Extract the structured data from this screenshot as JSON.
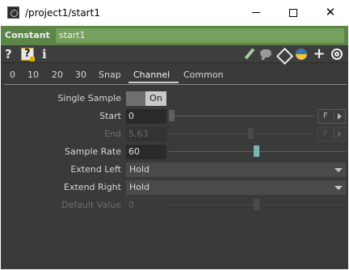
{
  "window": {
    "title": "/project1/start1"
  },
  "header": {
    "op_type": "Constant",
    "op_name": "start1"
  },
  "toolbar": {
    "help_label": "?",
    "python_help_label": "?",
    "info_label": "i",
    "plus_label": "+"
  },
  "tabs": [
    {
      "label": "0"
    },
    {
      "label": "10"
    },
    {
      "label": "20"
    },
    {
      "label": "30"
    },
    {
      "label": "Snap"
    },
    {
      "label": "Channel"
    },
    {
      "label": "Common"
    }
  ],
  "active_tab": "Channel",
  "params": {
    "single_sample": {
      "label": "Single Sample",
      "value": "On"
    },
    "start": {
      "label": "Start",
      "value": "0",
      "f_label": "F"
    },
    "end": {
      "label": "End",
      "value": "5.63",
      "f_label": "F"
    },
    "sample_rate": {
      "label": "Sample Rate",
      "value": "60"
    },
    "extend_left": {
      "label": "Extend Left",
      "value": "Hold"
    },
    "extend_right": {
      "label": "Extend Right",
      "value": "Hold"
    },
    "default_value": {
      "label": "Default Value",
      "value": "0"
    }
  },
  "colors": {
    "header_green": "#5b8648",
    "name_field_green": "#77a05f",
    "panel_bg": "#3a3a3a",
    "slider_accent": "#7ab4b4"
  }
}
